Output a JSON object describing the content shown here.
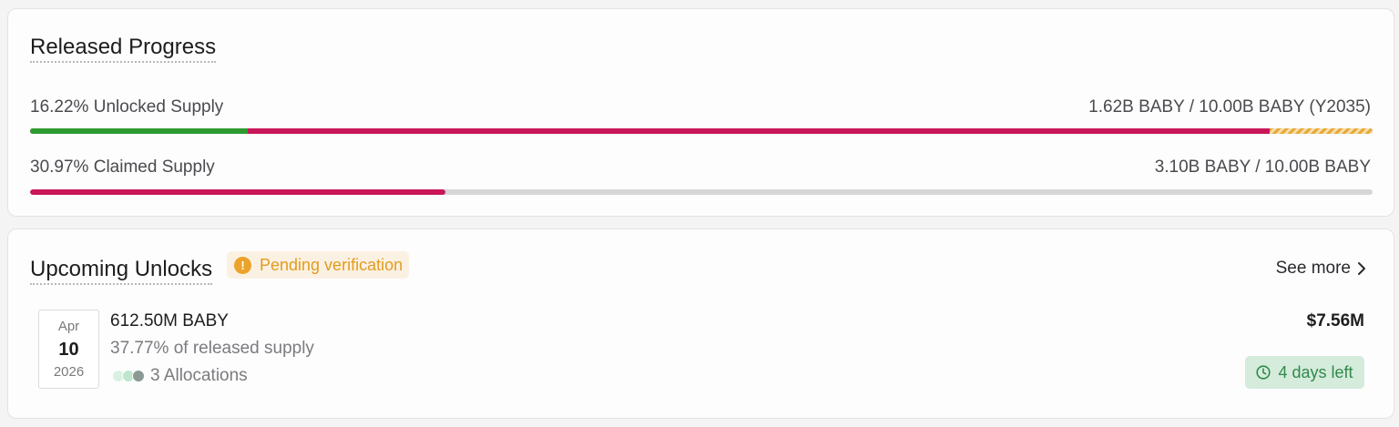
{
  "released_progress": {
    "title": "Released Progress",
    "unlocked": {
      "label": "16.22% Unlocked Supply",
      "value": "1.62B BABY / 10.00B BABY (Y2035)",
      "percent": 16.22,
      "colors": {
        "unlocked": "#2e9b31",
        "locked": "#c8185a",
        "future": "#e8a93a"
      }
    },
    "claimed": {
      "label": "30.97% Claimed Supply",
      "value": "3.10B BABY / 10.00B BABY",
      "percent": 30.97,
      "colors": {
        "claimed": "#c8185a",
        "track": "#d8d6d6"
      }
    }
  },
  "upcoming_unlocks": {
    "title": "Upcoming Unlocks",
    "pending_badge": {
      "icon": "exclamation-icon",
      "label": "Pending verification"
    },
    "see_more": {
      "label": "See more",
      "icon": "chevron-right-icon"
    },
    "items": [
      {
        "date": {
          "month": "Apr",
          "day": "10",
          "year": "2026"
        },
        "amount": "612.50M BABY",
        "percent_of_released": "37.77% of released supply",
        "allocations": "3 Allocations",
        "allocation_dot_colors": [
          "#d9f1e2",
          "#bfe5cd",
          "#8a9a92"
        ],
        "usd_value": "$7.56M",
        "time_left": {
          "icon": "clock-icon",
          "label": "4 days left"
        }
      }
    ]
  }
}
